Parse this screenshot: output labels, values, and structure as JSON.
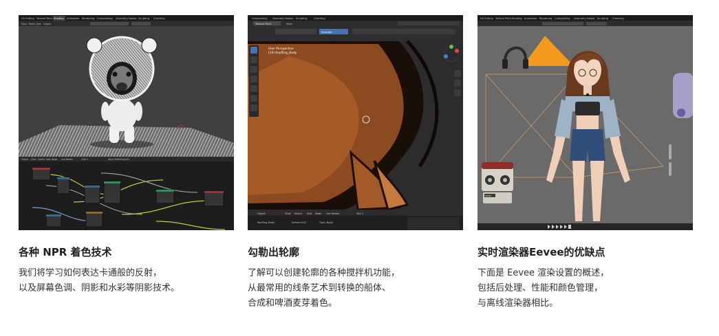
{
  "cards": [
    {
      "title": "各种 NPR 着色技术",
      "lines": [
        "我们将学习如何表达卡通般的反射，",
        "以及屏幕色调、阴影和水彩等阴影技术。"
      ],
      "screenshot": {
        "tabs": [
          "UV Editing",
          "Texture Paint",
          "Shading",
          "Animation",
          "Rendering",
          "Compositing",
          "Geometry Nodes",
          "Scripting",
          "Checking"
        ],
        "menu": [
          "View",
          "Select",
          "Add",
          "Object"
        ],
        "node_header": [
          "Object",
          "View",
          "Select",
          "Add",
          "Node",
          "Use Nodes",
          "Slot 1",
          "Resin Hatching.002"
        ]
      }
    },
    {
      "title": "勾勒出轮廓",
      "lines": [
        "了解可以创建轮廓的各种搅拌机功能，",
        "从最常用的线条艺术到转换的船体、",
        "合成和啤酒麦芽着色。"
      ],
      "screenshot": {
        "tabs": [
          "Compositing",
          "Geometry Nodes",
          "Scripting",
          "Checking"
        ],
        "mode": "Texture Paint",
        "view_label": "View",
        "brush_field": "Strength",
        "overlay_text": [
          "User Perspective",
          "(10) Keyfling_Body"
        ],
        "footer": [
          "Object",
          "View",
          "Select",
          "Add",
          "Node",
          "Use Nodes",
          "Slot 1"
        ],
        "breadcrumb": [
          "Keyfling_Body",
          "Sphere.014",
          "Tiger_Body"
        ]
      }
    },
    {
      "title": "实时渲染器Eevee的优缺点",
      "lines": [
        "下面是 Eevee 渲染设置的概述，",
        "包括后处理、性能和颜色管理，",
        "与离线渲染器相比。"
      ],
      "screenshot": {
        "tabs": [
          "UV Editing",
          "Texture Paint",
          "Shading",
          "Animation",
          "Rendering",
          "Compositing",
          "Geometry Nodes",
          "Scripting",
          "Checking"
        ],
        "radio_label": "SONIC"
      }
    }
  ],
  "colors": {
    "blender_bg": "#3d3d3d",
    "blender_dark": "#1d1d1d",
    "blender_header": "#2b2b2b",
    "accent_blue": "#4772b3",
    "fur_brown": "#8b4a1f",
    "orange_light": "#f39a1e"
  }
}
